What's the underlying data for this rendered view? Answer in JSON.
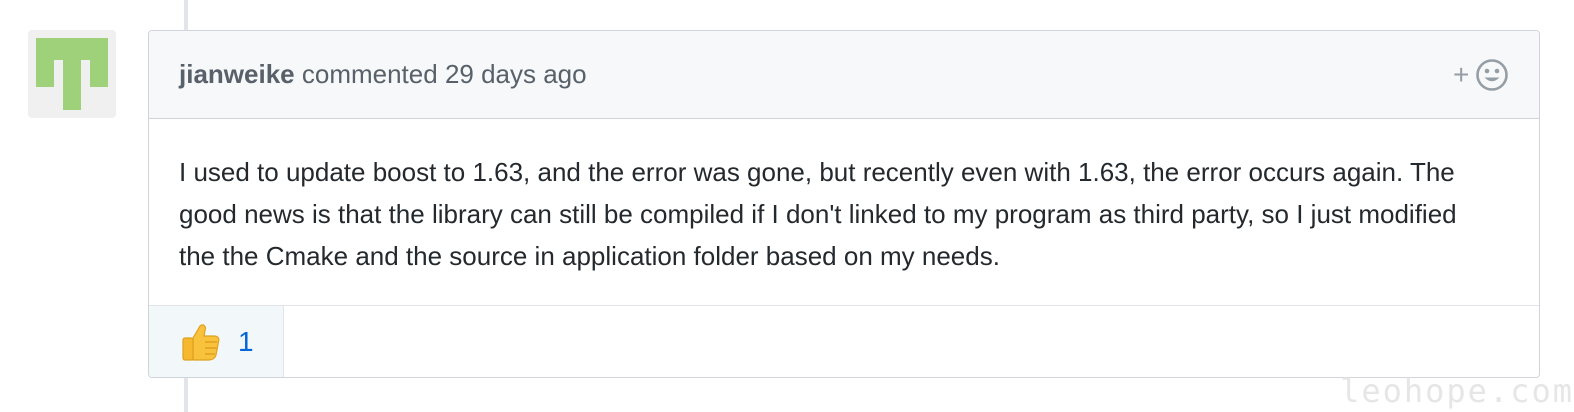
{
  "comment": {
    "author": "jianweike",
    "action": "commented",
    "timestamp": "29 days ago",
    "body": "I used to update boost to 1.63, and the error was gone, but recently even with 1.63, the error occurs again. The good news is that the library can still be compiled if I don't linked to my program as third party, so I just modified the the Cmake and the source in application folder based on my needs.",
    "reaction_picker": {
      "plus": "+",
      "icon": "smiley-icon"
    },
    "reactions": [
      {
        "icon": "thumbs-up-icon",
        "count": "1"
      }
    ]
  },
  "avatar": {
    "icon": "identicon-avatar",
    "color": "#9fd17b"
  },
  "watermark": "leohope.com",
  "colors": {
    "link": "#0366d6",
    "header_bg": "#f6f8fa",
    "border": "#d1d5da",
    "reaction_bg": "#f2f8fa"
  }
}
